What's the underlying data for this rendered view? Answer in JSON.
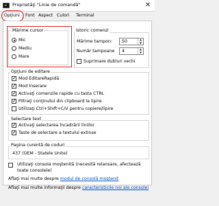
{
  "window": {
    "title": "Proprietăţi \"Linie de comandă\"",
    "close_glyph": "✕"
  },
  "tabs": [
    {
      "label": "Opţiuni",
      "active": true
    },
    {
      "label": "Font",
      "active": false
    },
    {
      "label": "Aspect",
      "active": false
    },
    {
      "label": "Culori",
      "active": false
    },
    {
      "label": "Terminal",
      "active": false
    }
  ],
  "cursor_size": {
    "title": "Mărime cursor",
    "options": [
      {
        "label": "Mic",
        "selected": true
      },
      {
        "label": "Mediu",
        "selected": false
      },
      {
        "label": "Mare",
        "selected": false
      }
    ]
  },
  "command_history": {
    "title": "Istoric comenzi",
    "buffer_size_label": "Mărime tampon:",
    "buffer_size_value": "50",
    "buffer_count_label": "Număr tampoane",
    "buffer_count_value": "4",
    "discard_duplicates_label": "Suprimare dubluri vechi",
    "discard_duplicates_checked": false
  },
  "edit_options": {
    "title": "Opţiuni de editare",
    "items": [
      {
        "label": "Mod EditareRapidă",
        "checked": true
      },
      {
        "label": "Mod Inserare",
        "checked": true
      },
      {
        "label": "Activaţi comenzile rapide cu tasta CTRL",
        "checked": true
      },
      {
        "label": "Filtraţi conţinutul din clipboard la lipire",
        "checked": true
      },
      {
        "label": "Utilizaţi Ctrl+Shift+C/V pentru copiere/lipire",
        "checked": false
      }
    ]
  },
  "text_selection": {
    "title": "Selectare text",
    "items": [
      {
        "label": "Activaţi selectarea încadrării liniilor",
        "checked": true
      },
      {
        "label": "Taste de selectare a textului extinse",
        "checked": true
      }
    ]
  },
  "codepage": {
    "title": "Pagina curentă de coduri",
    "value": "437   (OEM - Statele Unite)"
  },
  "legacy": {
    "checked": false,
    "label_line1": "Utilizaţi consola moştenită (necesită relansare, afectează",
    "label_line2": "toate consolele)"
  },
  "footer": {
    "link1_prefix": "Aflaţi mai multe despre ",
    "link1_text": "modul de consolă moştenit",
    "link2_prefix": "Aflaţi mai multe informaţii despre ",
    "link2_text": "caracteristicile noi ale consolei"
  },
  "colors": {
    "highlight": "#e02020",
    "link": "#0050c8"
  }
}
